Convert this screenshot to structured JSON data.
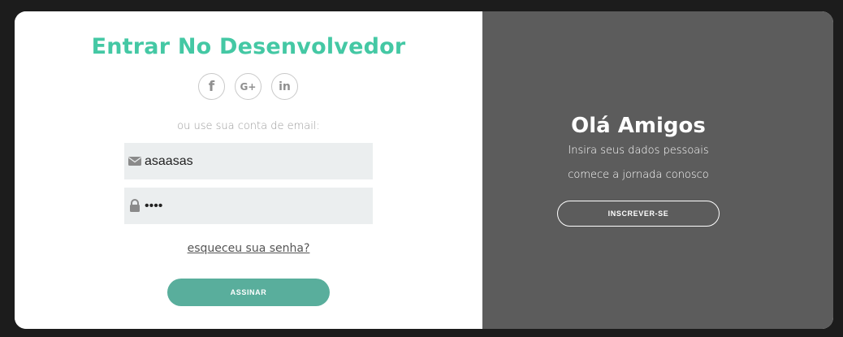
{
  "login": {
    "title": "Entrar No Desenvolvedor",
    "social": [
      {
        "icon": "facebook-icon",
        "glyph": "f"
      },
      {
        "icon": "google-plus-icon",
        "glyph": "G+"
      },
      {
        "icon": "linkedin-icon",
        "glyph": "in"
      }
    ],
    "subtitle": "ou use sua conta de email:",
    "email": {
      "value": "asaasas",
      "icon": "envelope-icon"
    },
    "password": {
      "value": "••••",
      "icon": "lock-icon"
    },
    "forgot_link": "esqueceu sua senha?",
    "submit_label": "ASSINAR"
  },
  "panel": {
    "heading": "Olá Amigos",
    "line1": "Insira seus dados pessoais",
    "line2": "comece a jornada conosco",
    "register_label": "INSCREVER-SE"
  },
  "colors": {
    "accent": "#44c8a4",
    "button": "#59ae9c",
    "panel_bg": "#5c5c5c",
    "field_bg": "#ebeeef"
  }
}
